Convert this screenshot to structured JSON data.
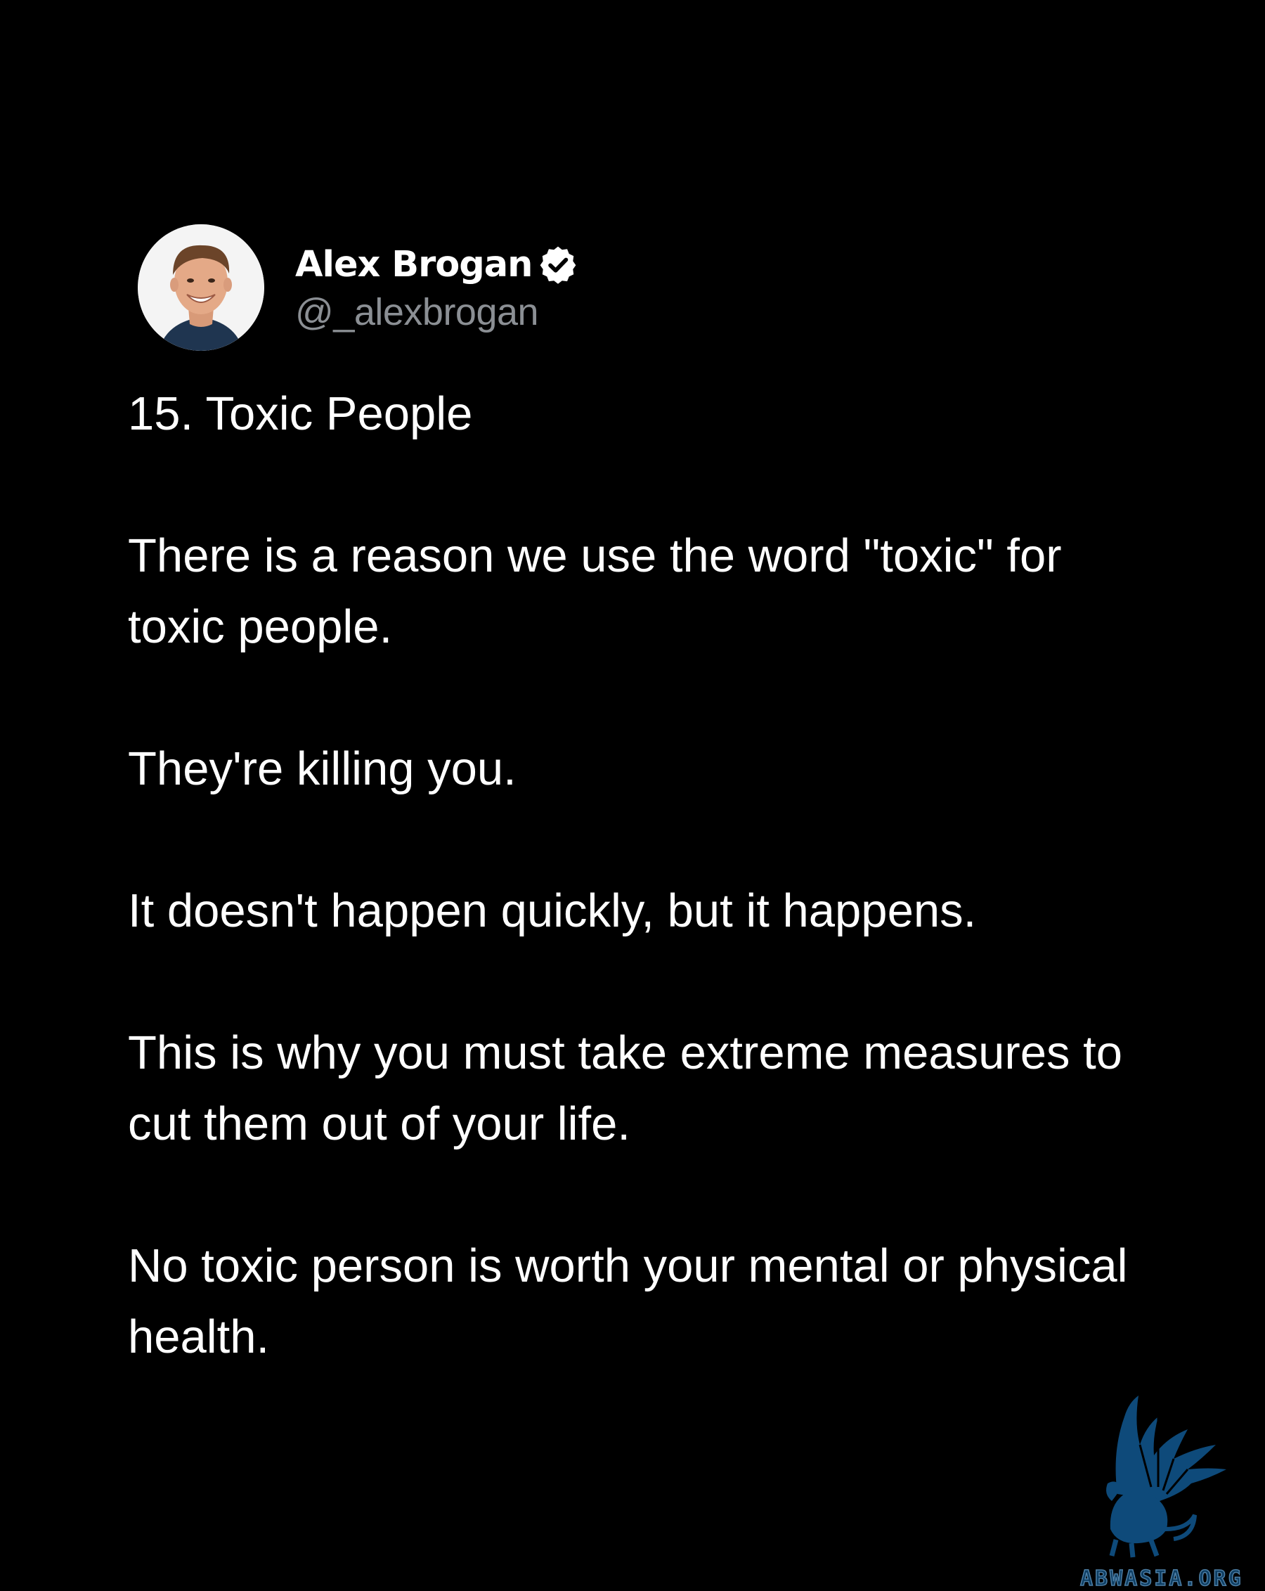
{
  "author": {
    "display_name": "Alex Brogan",
    "handle": "@_alexbrogan",
    "verified": true,
    "avatar_icon": "profile-photo"
  },
  "post": {
    "paragraphs": [
      "15. Toxic People",
      "There is a reason we use the word \"toxic\" for toxic people.",
      "They're killing you.",
      "It doesn't happen quickly, but it happens.",
      "This is why you must take extreme measures to cut them out of your life.",
      "No toxic person is worth your mental or physical health."
    ]
  },
  "watermark": {
    "text": "ABWASIA.ORG",
    "icon": "griffin-logo",
    "color": "#0e4a7a"
  },
  "colors": {
    "background": "#000000",
    "text": "#ffffff",
    "handle": "#8b8f94"
  }
}
